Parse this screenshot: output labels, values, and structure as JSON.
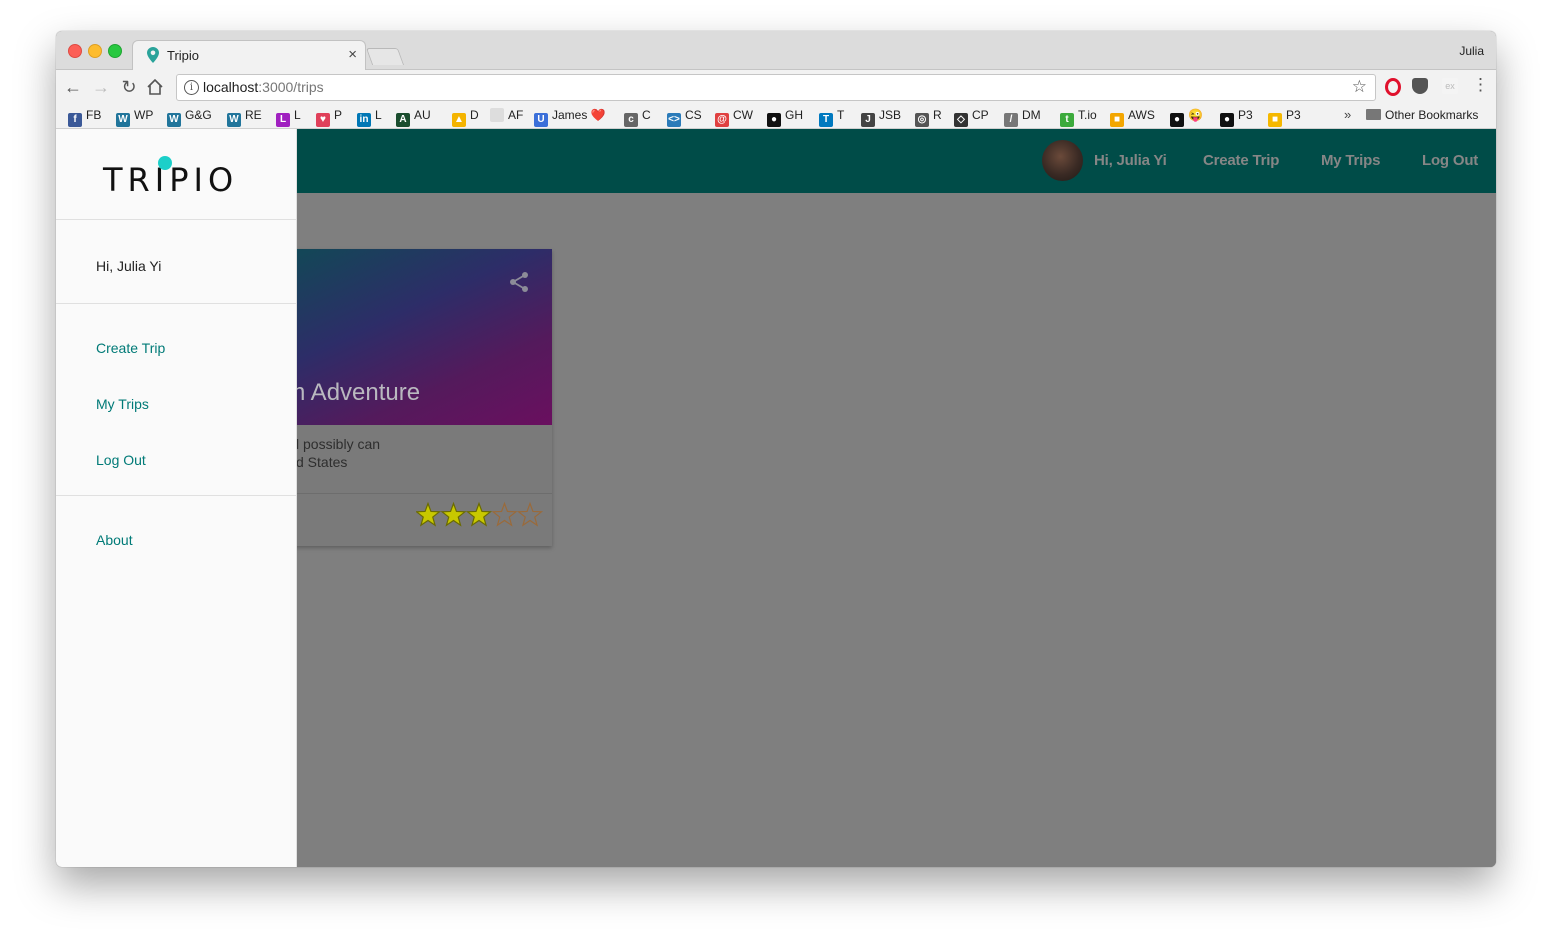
{
  "browser": {
    "tab_title": "Tripio",
    "tab_close": "×",
    "profile_name": "Julia",
    "url_host": "localhost",
    "url_path": ":3000/trips",
    "overflow": "»",
    "other_bookmarks": "Other Bookmarks",
    "bookmarks": [
      {
        "label": "FB",
        "color": "#3b5998",
        "glyph": "f"
      },
      {
        "label": "WP",
        "color": "#21759b",
        "glyph": "W"
      },
      {
        "label": "G&G",
        "color": "#21759b",
        "glyph": "W"
      },
      {
        "label": "RE",
        "color": "#21759b",
        "glyph": "W"
      },
      {
        "label": "L",
        "color": "#a020c0",
        "glyph": "L"
      },
      {
        "label": "P",
        "color": "#e0405a",
        "glyph": "♥"
      },
      {
        "label": "L",
        "color": "#0077b5",
        "glyph": "in"
      },
      {
        "label": "AU",
        "color": "#1a4d2e",
        "glyph": "A"
      },
      {
        "label": "D",
        "color": "#f4b400",
        "glyph": "▲"
      },
      {
        "label": "AF",
        "color": "#dddddd",
        "glyph": ""
      },
      {
        "label": "James ❤️",
        "color": "#3b6fd9",
        "glyph": "U"
      },
      {
        "label": "C",
        "color": "#666666",
        "glyph": "c"
      },
      {
        "label": "CS",
        "color": "#2b7bb9",
        "glyph": "<>"
      },
      {
        "label": "CW",
        "color": "#e04040",
        "glyph": "@"
      },
      {
        "label": "GH",
        "color": "#111111",
        "glyph": "●"
      },
      {
        "label": "T",
        "color": "#0079bf",
        "glyph": "T"
      },
      {
        "label": "JSB",
        "color": "#444444",
        "glyph": "J"
      },
      {
        "label": "R",
        "color": "#555555",
        "glyph": "◎"
      },
      {
        "label": "CP",
        "color": "#333333",
        "glyph": "◇"
      },
      {
        "label": "DM",
        "color": "#777777",
        "glyph": "/"
      },
      {
        "label": "T.io",
        "color": "#3caa3c",
        "glyph": "t"
      },
      {
        "label": "AWS",
        "color": "#f3a600",
        "glyph": "■"
      },
      {
        "label": "😜",
        "color": "#111111",
        "glyph": "●"
      },
      {
        "label": "P3",
        "color": "#111111",
        "glyph": "●"
      },
      {
        "label": "P3",
        "color": "#f5b800",
        "glyph": "■"
      }
    ]
  },
  "appbar": {
    "greeting": "Hi, Julia Yi",
    "create_trip": "Create Trip",
    "my_trips": "My Trips",
    "log_out": "Log Out"
  },
  "card": {
    "title": "am Adventure",
    "line1": "l possibly can",
    "line2": "d States",
    "rating": 3,
    "rating_max": 5
  },
  "drawer": {
    "logo": "TRIPIO",
    "greeting": "Hi, Julia Yi",
    "create_trip": "Create Trip",
    "my_trips": "My Trips",
    "log_out": "Log Out",
    "about": "About"
  },
  "colors": {
    "appbar": "#004c48",
    "accent": "#1ccfc9",
    "link": "#007a77",
    "star_fill": "#c8c800"
  }
}
